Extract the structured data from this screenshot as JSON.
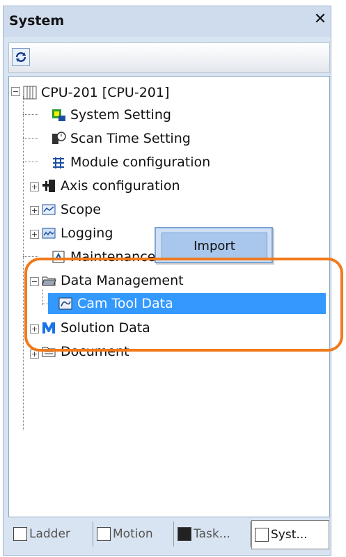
{
  "panel": {
    "title": "System",
    "close_label": "✕"
  },
  "tree": {
    "root": "CPU-201 [CPU-201]",
    "items": [
      {
        "label": "System Setting"
      },
      {
        "label": "Scan Time Setting"
      },
      {
        "label": "Module configuration"
      },
      {
        "label": "Axis configuration"
      },
      {
        "label": "Scope"
      },
      {
        "label": "Logging"
      },
      {
        "label": "Maintenance Monitor"
      },
      {
        "label": "Data Management"
      },
      {
        "label": "Cam Tool Data"
      },
      {
        "label": "Solution Data"
      },
      {
        "label": "Document"
      }
    ]
  },
  "context_menu": {
    "import_label": "Import"
  },
  "tabs": [
    {
      "label": "Ladder"
    },
    {
      "label": "Motion"
    },
    {
      "label": "Task..."
    },
    {
      "label": "Syst..."
    }
  ],
  "colors": {
    "selection": "#3399ff",
    "highlight": "#f07a1c"
  }
}
